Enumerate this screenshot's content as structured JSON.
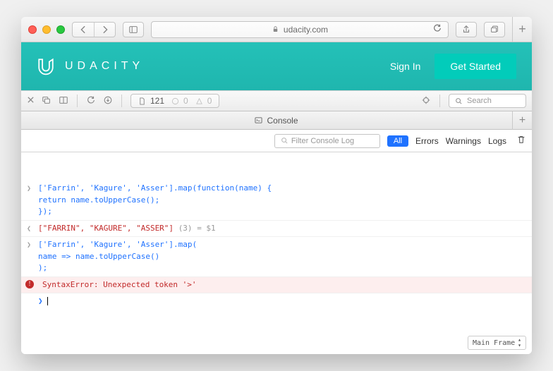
{
  "titlebar": {
    "url_host": "udacity.com"
  },
  "site": {
    "logo_text": "UDACITY",
    "signin": "Sign In",
    "getstarted": "Get Started"
  },
  "devbar": {
    "resource_count": "121",
    "zero_a": "0",
    "zero_b": "0",
    "search_placeholder": "Search"
  },
  "console_tab": {
    "label": "Console"
  },
  "filterbar": {
    "filter_placeholder": "Filter Console Log",
    "all": "All",
    "errors": "Errors",
    "warnings": "Warnings",
    "logs": "Logs"
  },
  "console": {
    "entries": [
      {
        "type": "input",
        "lines": [
          "['Farrin', 'Kagure', 'Asser'].map(function(name) {",
          "    return name.toUpperCase();",
          "  });"
        ]
      },
      {
        "type": "output",
        "result_array": "[\"FARRIN\", \"KAGURE\", \"ASSER\"]",
        "count": "(3)",
        "assign": "= $1"
      },
      {
        "type": "input",
        "lines": [
          "['Farrin', 'Kagure', 'Asser'].map(",
          "    name => name.toUpperCase()",
          "  );"
        ]
      },
      {
        "type": "error",
        "message": "SyntaxError: Unexpected token '>'"
      }
    ],
    "frame_label": "Main Frame"
  }
}
